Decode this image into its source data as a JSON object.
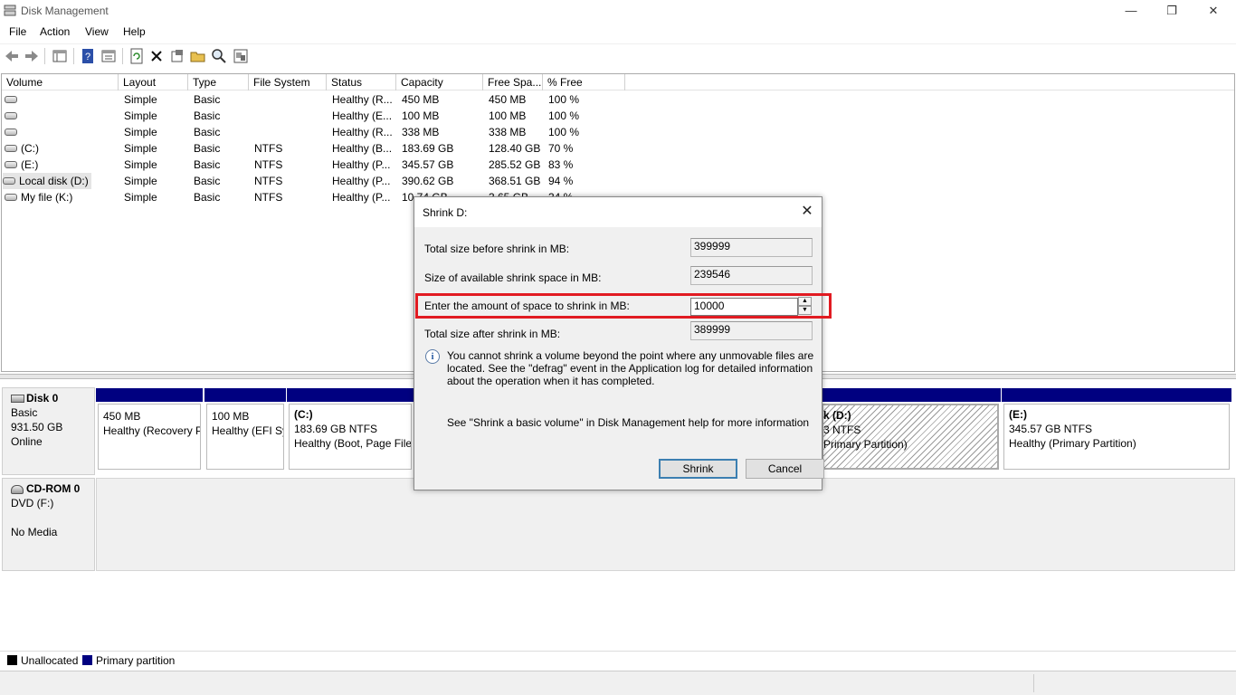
{
  "window": {
    "title": "Disk Management",
    "minimize": "—",
    "restore": "❐",
    "close": "✕"
  },
  "menu": [
    "File",
    "Action",
    "View",
    "Help"
  ],
  "toolbar": [
    "back-icon",
    "forward-icon",
    "console-tree-icon",
    "help-icon",
    "properties-list-icon",
    "refresh-icon",
    "delete-icon",
    "properties-icon",
    "open-icon",
    "explore-icon",
    "help-topics-icon"
  ],
  "volume_table": {
    "columns": [
      "Volume",
      "Layout",
      "Type",
      "File System",
      "Status",
      "Capacity",
      "Free Spa...",
      "% Free"
    ],
    "rows": [
      [
        "",
        "Simple",
        "Basic",
        "",
        "Healthy (R...",
        "450 MB",
        "450 MB",
        "100 %"
      ],
      [
        "",
        "Simple",
        "Basic",
        "",
        "Healthy (E...",
        "100 MB",
        "100 MB",
        "100 %"
      ],
      [
        "",
        "Simple",
        "Basic",
        "",
        "Healthy (R...",
        "338 MB",
        "338 MB",
        "100 %"
      ],
      [
        "(C:)",
        "Simple",
        "Basic",
        "NTFS",
        "Healthy (B...",
        "183.69 GB",
        "128.40 GB",
        "70 %"
      ],
      [
        "(E:)",
        "Simple",
        "Basic",
        "NTFS",
        "Healthy (P...",
        "345.57 GB",
        "285.52 GB",
        "83 %"
      ],
      [
        "Local disk (D:)",
        "Simple",
        "Basic",
        "NTFS",
        "Healthy (P...",
        "390.62 GB",
        "368.51 GB",
        "94 %"
      ],
      [
        "My file (K:)",
        "Simple",
        "Basic",
        "NTFS",
        "Healthy (P...",
        "10.74 GB",
        "3.65 GB",
        "34 %"
      ]
    ]
  },
  "disk0": {
    "name": "Disk 0",
    "type": "Basic",
    "size": "931.50 GB",
    "status": "Online",
    "partitions": [
      {
        "title": "",
        "size": "450 MB",
        "status": "Healthy (Recovery P"
      },
      {
        "title": "",
        "size": "100 MB",
        "status": "Healthy (EFI Sy"
      },
      {
        "title": "(C:)",
        "size": "183.69 GB NTFS",
        "status": "Healthy (Boot, Page File,"
      },
      {
        "title": "k  (D:)",
        "size": "3 NTFS",
        "status": "Primary Partition)"
      },
      {
        "title": "(E:)",
        "size": "345.57 GB NTFS",
        "status": "Healthy (Primary Partition)"
      }
    ]
  },
  "cdrom0": {
    "name": "CD-ROM 0",
    "type": "DVD (F:)",
    "status": "No Media"
  },
  "legend": [
    {
      "label": "Unallocated",
      "color": "#000000"
    },
    {
      "label": "Primary partition",
      "color": "#000080"
    }
  ],
  "dialog": {
    "title": "Shrink D:",
    "total_before_label": "Total size before shrink in MB:",
    "total_before_value": "399999",
    "available_label": "Size of available shrink space in MB:",
    "available_value": "239546",
    "amount_label": "Enter the amount of space to shrink in MB:",
    "amount_value": "10000",
    "total_after_label": "Total size after shrink in MB:",
    "total_after_value": "389999",
    "info_text": "You cannot shrink a volume beyond the point where any unmovable files are located. See the \"defrag\" event in the Application log for detailed information about the operation when it has completed.",
    "help_text": "See \"Shrink a basic volume\" in Disk Management help for more information",
    "shrink_button": "Shrink",
    "cancel_button": "Cancel",
    "highlight_color": "#e11b22"
  }
}
